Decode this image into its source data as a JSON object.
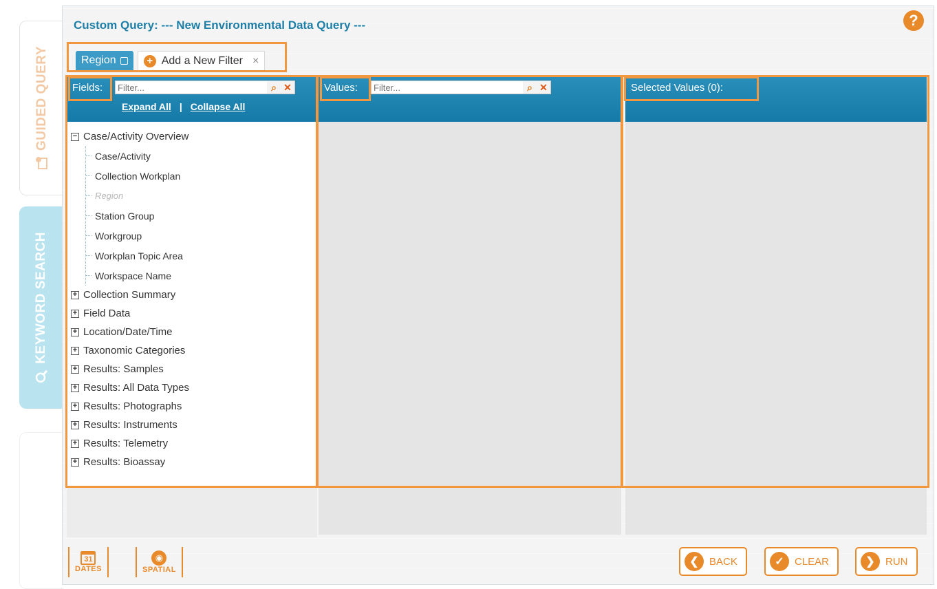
{
  "rail": {
    "guided_label": "GUIDED QUERY",
    "keyword_label": "KEYWORD SEARCH"
  },
  "header": {
    "title": "Custom Query: --- New Environmental Data Query ---",
    "help_symbol": "?"
  },
  "tabs": {
    "region_label": "Region",
    "add_label": "Add a New Filter",
    "close_symbol": "×"
  },
  "fields": {
    "label": "Fields:",
    "filter_placeholder": "Filter...",
    "expand_all": "Expand All",
    "separator": "|",
    "collapse_all": "Collapse All",
    "tree": [
      {
        "label": "Case/Activity Overview",
        "expanded": true,
        "children": [
          {
            "label": "Case/Activity",
            "disabled": false
          },
          {
            "label": "Collection Workplan",
            "disabled": false
          },
          {
            "label": "Region",
            "disabled": true
          },
          {
            "label": "Station Group",
            "disabled": false
          },
          {
            "label": "Workgroup",
            "disabled": false
          },
          {
            "label": "Workplan Topic Area",
            "disabled": false
          },
          {
            "label": "Workspace Name",
            "disabled": false
          }
        ]
      },
      {
        "label": "Collection Summary",
        "expanded": false
      },
      {
        "label": "Field Data",
        "expanded": false
      },
      {
        "label": "Location/Date/Time",
        "expanded": false
      },
      {
        "label": "Taxonomic Categories",
        "expanded": false
      },
      {
        "label": "Results: Samples",
        "expanded": false
      },
      {
        "label": "Results: All Data Types",
        "expanded": false
      },
      {
        "label": "Results: Photographs",
        "expanded": false
      },
      {
        "label": "Results: Instruments",
        "expanded": false
      },
      {
        "label": "Results: Telemetry",
        "expanded": false
      },
      {
        "label": "Results: Bioassay",
        "expanded": false
      }
    ]
  },
  "values": {
    "label": "Values:",
    "filter_placeholder": "Filter..."
  },
  "selected": {
    "label": "Selected Values (0):"
  },
  "toolbar": {
    "dates_label": "DATES",
    "dates_day": "31",
    "spatial_label": "SPATIAL",
    "back_label": "BACK",
    "clear_label": "CLEAR",
    "run_label": "RUN"
  },
  "colors": {
    "accent": "#e8892a",
    "header_blue": "#1d7fa8",
    "highlight": "#f0973f"
  }
}
